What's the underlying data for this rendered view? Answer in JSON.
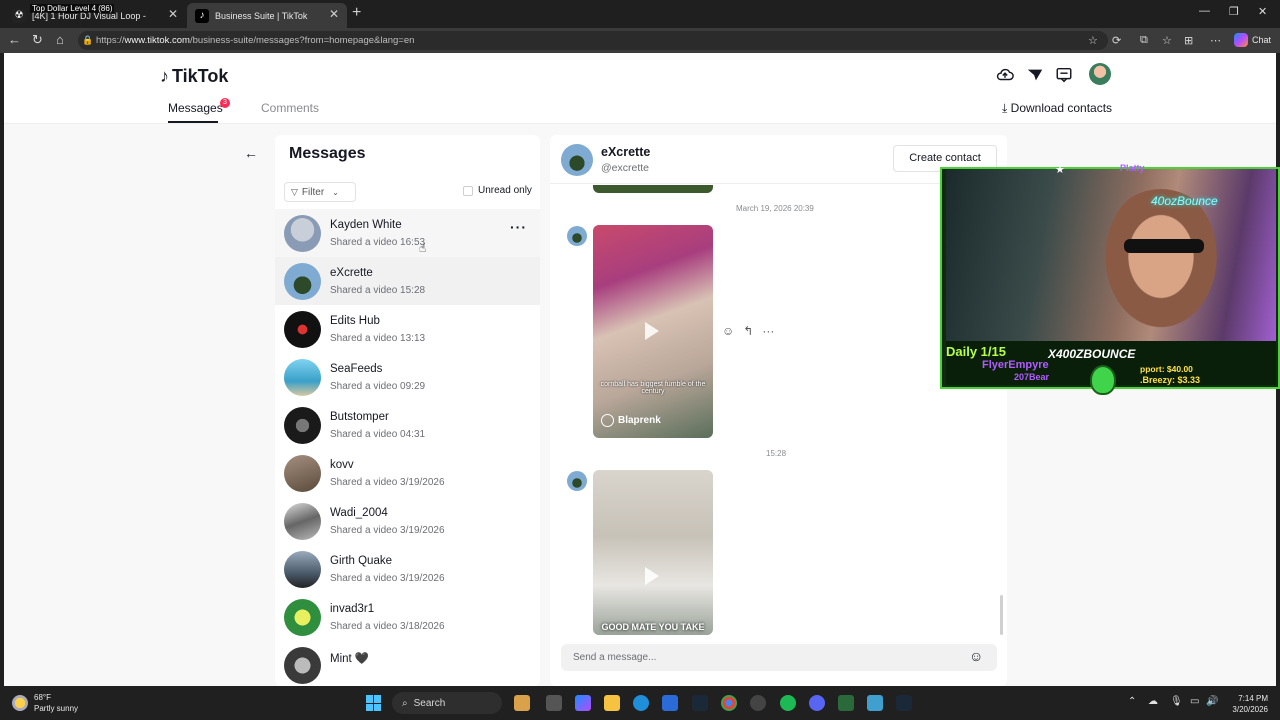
{
  "browser": {
    "tabs": [
      {
        "title": "[4K] 1 Hour DJ Visual Loop -",
        "badge": "Top Dollar Level 4 (86)"
      },
      {
        "title": "Business Suite | TikTok"
      }
    ],
    "url_prefix": "https://",
    "url_host": "www.tiktok.com",
    "url_path": "/business-suite/messages?from=homepage&lang=en",
    "chat_label": "Chat"
  },
  "header": {
    "logo": "TikTok",
    "tabs": [
      {
        "label": "Messages",
        "badge": "3"
      },
      {
        "label": "Comments"
      }
    ],
    "download_label": "Download contacts"
  },
  "messages_panel": {
    "title": "Messages",
    "filter_label": "Filter",
    "unread_label": "Unread only",
    "conversations": [
      {
        "name": "Kayden White",
        "sub": "Shared a video 16:53",
        "color": "#8a9bb5"
      },
      {
        "name": "eXcrette",
        "sub": "Shared a video 15:28",
        "color": "#5d7f9f"
      },
      {
        "name": "Edits Hub",
        "sub": "Shared a video 13:13",
        "color": "#1a1a1a"
      },
      {
        "name": "SeaFeeds",
        "sub": "Shared a video 09:29",
        "color": "#3aa0c8"
      },
      {
        "name": "Butstomper",
        "sub": "Shared a video 04:31",
        "color": "#2a2a2a"
      },
      {
        "name": "kovv",
        "sub": "Shared a video 3/19/2026",
        "color": "#7d6a5a"
      },
      {
        "name": "Wadi_2004",
        "sub": "Shared a video 3/19/2026",
        "color": "#9a9a9a"
      },
      {
        "name": "Girth Quake",
        "sub": "Shared a video 3/19/2026",
        "color": "#4a5a6a"
      },
      {
        "name": "invad3r1",
        "sub": "Shared a video 3/18/2026",
        "color": "#2f8f3f"
      },
      {
        "name": "Mint 🖤",
        "sub": "",
        "color": "#3a3a3a"
      }
    ]
  },
  "chat": {
    "name": "eXcrette",
    "handle": "@excrette",
    "create_contact": "Create contact",
    "timestamp1": "March 19, 2026 20:39",
    "video1_caption": "cornball has biggest fumble of the century",
    "video1_author": "Blaprenk",
    "timestamp2": "15:28",
    "video2_caption": "GOOD MATE YOU TAKE",
    "composer_placeholder": "Send a message..."
  },
  "overlay": {
    "daily": "Daily 1/15",
    "streamer": "X400ZBOUNCE",
    "line1": "FlyerEmpyre",
    "line2": "207Bear",
    "support1": "pport: $40.00",
    "support2": ".Breezy: $3.33",
    "top_label": "Platty",
    "neon": "40ozBounce"
  },
  "taskbar": {
    "temp": "68°F",
    "weather": "Partly sunny",
    "search": "Search",
    "time": "7:14 PM",
    "date": "3/20/2026"
  }
}
